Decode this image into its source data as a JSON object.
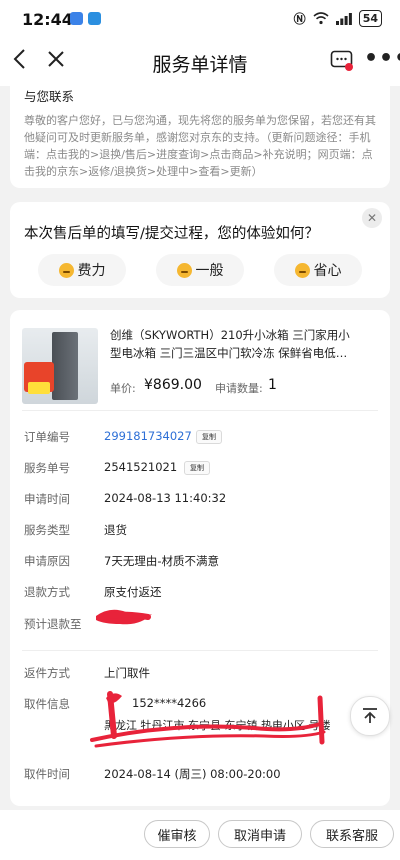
{
  "status_bar": {
    "time": "12:44",
    "battery": "54"
  },
  "nav": {
    "title": "服务单详情"
  },
  "notice": {
    "title": "与您联系",
    "body": "尊敬的客户您好，已与您沟通，现先将您的服务单为您保留，若您还有其他疑问可及时更新服务单，感谢您对京东的支持。（更新问题途径：手机端：点击我的>退换/售后>进度查询>点击商品>补充说明；网页端：点击我的京东>返修/退换货>处理中>查看>更新）"
  },
  "survey": {
    "question": "本次售后单的填写/提交过程，您的体验如何？",
    "options": [
      "费力",
      "一般",
      "省心"
    ]
  },
  "product": {
    "name": "创维（SKYWORTH）210升小冰箱 三门家用小型电冰箱 三门三温区中门软冷冻 保鲜省电低…",
    "price_label": "单价:",
    "price": "¥869.00",
    "qty_label": "申请数量:",
    "qty": "1"
  },
  "details": {
    "copy_label": "复制",
    "rows": [
      {
        "label": "订单编号",
        "value": "299181734027"
      },
      {
        "label": "服务单号",
        "value": "2541521021"
      },
      {
        "label": "申请时间",
        "value": "2024-08-13 11:40:32"
      },
      {
        "label": "服务类型",
        "value": "退货"
      },
      {
        "label": "申请原因",
        "value": "7天无理由-材质不满意"
      },
      {
        "label": "退款方式",
        "value": "原支付返还"
      },
      {
        "label": "预计退款至",
        "value": ""
      }
    ]
  },
  "pickup": {
    "method_label": "返件方式",
    "method": "上门取件",
    "info_label": "取件信息",
    "phone": "152****4266",
    "address": "黑龙江 牡丹江市 东宁县 东宁镇 热电小区 号楼",
    "time_label": "取件时间",
    "time": "2024-08-14 (周三) 08:00-20:00"
  },
  "bottom": {
    "buttons": [
      "催审核",
      "取消申请",
      "联系客服"
    ]
  },
  "colors": {
    "accent_link": "#2d6fd6",
    "scribble_red": "#e8233a"
  }
}
